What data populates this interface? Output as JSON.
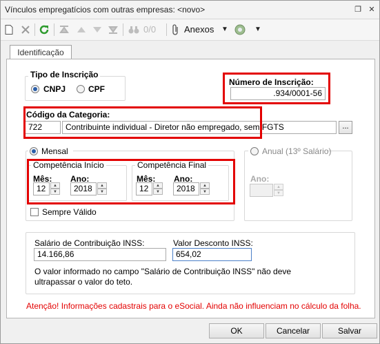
{
  "window": {
    "title": "Vínculos empregatícios com outras empresas: <novo>",
    "controls": {
      "restore": "❐",
      "close": "✕"
    }
  },
  "toolbar": {
    "page_counter": "0/0",
    "attachments_label": "Anexos"
  },
  "tabs": [
    {
      "label": "Identificação"
    }
  ],
  "tipo_inscricao": {
    "label": "Tipo de Inscrição",
    "options": [
      "CNPJ",
      "CPF"
    ],
    "selected": "CNPJ"
  },
  "numero_inscricao": {
    "label": "Número de Inscrição:",
    "value": ".934/0001-56"
  },
  "categoria": {
    "label": "Código da Categoria:",
    "code": "722",
    "description": "Contribuinte individual - Diretor não empregado, sem FGTS",
    "lookup_button": "..."
  },
  "periodo": {
    "mensal_label": "Mensal",
    "anual_label": "Anual (13º Salário)",
    "selected": "Mensal",
    "competencia_inicio": {
      "label": "Competência Início",
      "mes_label": "Mês:",
      "mes": "12",
      "ano_label": "Ano:",
      "ano": "2018"
    },
    "competencia_final": {
      "label": "Competência Final",
      "mes_label": "Mês:",
      "mes": "12",
      "ano_label": "Ano:",
      "ano": "2018"
    },
    "anual_ano_label": "Ano:",
    "anual_ano": "",
    "sempre_valido_label": "Sempre Válido",
    "sempre_valido_checked": false
  },
  "valores": {
    "salario_label": "Salário de Contribuição INSS:",
    "salario_value": "14.166,86",
    "desconto_label": "Valor Desconto INSS:",
    "desconto_value": "654,02",
    "note": "O valor informado no campo \"Salário de Contribuição INSS\" não deve ultrapassar o valor do teto."
  },
  "warning": "Atenção! Informações cadastrais para o eSocial. Ainda não influenciam no cálculo da folha.",
  "buttons": {
    "ok": "OK",
    "cancel": "Cancelar",
    "save": "Salvar"
  },
  "colors": {
    "highlight": "#e30000",
    "accent": "#2b5ea8",
    "warning_text": "#e30000"
  }
}
